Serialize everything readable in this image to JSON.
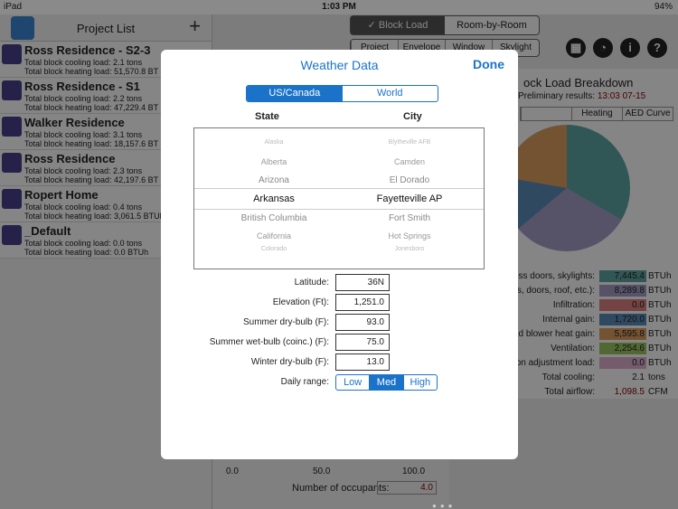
{
  "status_bar": {
    "carrier": "iPad",
    "time": "1:03 PM",
    "battery": "94%"
  },
  "sidebar": {
    "title": "Project List",
    "add_glyph": "+",
    "projects": [
      {
        "name": "Ross Residence - S2-3",
        "cooling": "Total block cooling load: 2.1 tons",
        "heating": "Total block heating load: 51,570.8 BT"
      },
      {
        "name": "Ross Residence - S1",
        "cooling": "Total block cooling load: 2.2 tons",
        "heating": "Total block heating load: 47,229.4 BT"
      },
      {
        "name": "Walker Residence",
        "cooling": "Total block cooling load: 3.1 tons",
        "heating": "Total block heating load: 18,157.6 BT"
      },
      {
        "name": "Ross Residence",
        "cooling": "Total block cooling load: 2.3 tons",
        "heating": "Total block heating load: 42,197.6 BT"
      },
      {
        "name": "Ropert Home",
        "cooling": "Total block cooling load: 0.4 tons",
        "heating": "Total block heating load: 3,061.5 BTUh"
      },
      {
        "name": "_Default",
        "cooling": "Total block cooling load: 0.0 tons",
        "heating": "Total block heating load: 0.0 BTUh"
      }
    ]
  },
  "main": {
    "top_tabs": [
      "✓ Block Load",
      "Room-by-Room"
    ],
    "sub_tabs": [
      "Project",
      "Envelope",
      "Window",
      "Skylight"
    ],
    "tool_icons": [
      "calculator-icon",
      "pie-chart-icon",
      "info-icon",
      "help-icon"
    ],
    "breakdown_title": "ock Load Breakdown",
    "prelim_label": "Preliminary results:",
    "prelim_time": "13:03 07-15",
    "result_tabs": [
      "",
      "Heating",
      "AED Curve"
    ],
    "legend": [
      {
        "label": "ss doors, skylights:",
        "value": "7,445.4",
        "unit": "BTUh",
        "color": "#5da8a4"
      },
      {
        "label": "s, doors, roof, etc.):",
        "value": "8,289.8",
        "unit": "BTUh",
        "color": "#a6a0c8"
      },
      {
        "label": "Infiltration:",
        "value": "0.0",
        "unit": "BTUh",
        "color": "#e08080"
      },
      {
        "label": "Internal gain:",
        "value": "1,720.0",
        "unit": "BTUh",
        "color": "#5a8fb8"
      },
      {
        "label": "d blower heat gain:",
        "value": "5,595.8",
        "unit": "BTUh",
        "color": "#e0a060"
      },
      {
        "label": "Ventilation:",
        "value": "2,254.6",
        "unit": "BTUh",
        "color": "#9cc860"
      },
      {
        "label": "on adjustment load:",
        "value": "0.0",
        "unit": "BTUh",
        "color": "#e0b0d0"
      },
      {
        "label": "Total cooling:",
        "value": "2.1",
        "unit": "tons",
        "color": ""
      },
      {
        "label": "Total airflow:",
        "value": "1,098.5",
        "unit": "CFM",
        "color": ""
      }
    ],
    "slider_ticks": [
      "0.0",
      "50.0",
      "100.0"
    ],
    "occupants_label": "Number of occupants:",
    "occupants_value": "4.0"
  },
  "modal": {
    "title": "Weather Data",
    "done_label": "Done",
    "region_tabs": [
      "US/Canada",
      "World"
    ],
    "region_selected": 0,
    "state_header": "State",
    "city_header": "City",
    "picker_rows": [
      {
        "state": "Alaska",
        "city": "Blytheville AFB"
      },
      {
        "state": "Alberta",
        "city": "Camden"
      },
      {
        "state": "Arizona",
        "city": "El Dorado"
      },
      {
        "state": "Arkansas",
        "city": "Fayetteville AP"
      },
      {
        "state": "British Columbia",
        "city": "Fort Smith"
      },
      {
        "state": "California",
        "city": "Hot Springs"
      },
      {
        "state": "Colorado",
        "city": "Jonesboro"
      }
    ],
    "fields": [
      {
        "label": "Latitude:",
        "value": "36N"
      },
      {
        "label": "Elevation (Ft):",
        "value": "1,251.0"
      },
      {
        "label": "Summer dry-bulb (F):",
        "value": "93.0"
      },
      {
        "label": "Summer wet-bulb (coinc.) (F):",
        "value": "75.0"
      },
      {
        "label": "Winter dry-bulb (F):",
        "value": "13.0"
      }
    ],
    "daily_range_label": "Daily range:",
    "daily_range_options": [
      "Low",
      "Med",
      "High"
    ],
    "daily_range_selected": 1
  }
}
